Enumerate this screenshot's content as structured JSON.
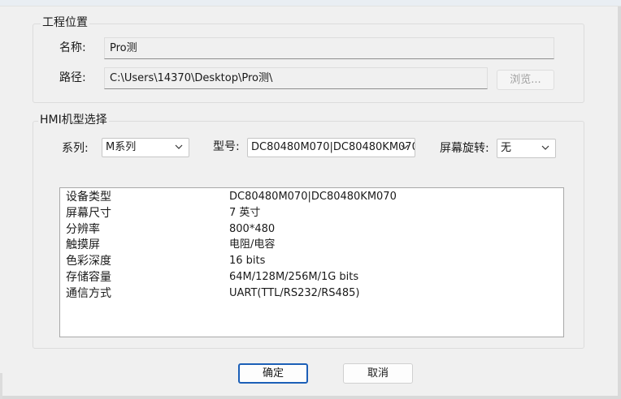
{
  "project_location": {
    "group_title": "工程位置",
    "name_label": "名称:",
    "name_value": "Pro测",
    "path_label": "路径:",
    "path_value": "C:\\Users\\14370\\Desktop\\Pro测\\",
    "browse_label": "浏览..."
  },
  "hmi_select": {
    "group_title": "HMI机型选择",
    "series_label": "系列:",
    "series_value": "M系列",
    "model_label": "型号:",
    "model_value": "DC80480M070|DC80480KM070",
    "rotation_label": "屏幕旋转:",
    "rotation_value": "无"
  },
  "specs": [
    {
      "key": "设备类型",
      "value": "DC80480M070|DC80480KM070"
    },
    {
      "key": "屏幕尺寸",
      "value": "7 英寸"
    },
    {
      "key": "分辨率",
      "value": "800*480"
    },
    {
      "key": "触摸屏",
      "value": "电阻/电容"
    },
    {
      "key": "色彩深度",
      "value": "16 bits"
    },
    {
      "key": "存储容量",
      "value": "64M/128M/256M/1G bits"
    },
    {
      "key": "通信方式",
      "value": "UART(TTL/RS232/RS485)"
    }
  ],
  "buttons": {
    "ok": "确定",
    "cancel": "取消"
  },
  "colors": {
    "background": "#f0f0f0",
    "focus_border": "#1c5fb7",
    "list_background": "#ffffff"
  }
}
